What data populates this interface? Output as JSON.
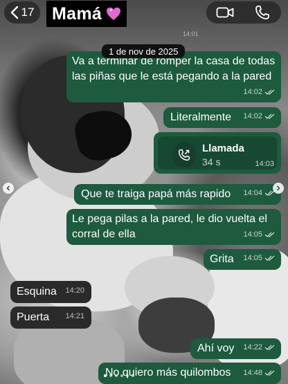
{
  "header": {
    "back_count": "17",
    "contact_name": "Mamá",
    "heart_icon": "purple-heart-icon",
    "video_icon": "video-camera-icon",
    "phone_icon": "phone-icon"
  },
  "date_chip": "1 de nov de 2025",
  "messages": [
    {
      "direction": "out",
      "text": "Va a terminar de romper la casa de todas las piñas que le está pegando a la pared",
      "time": "14:02",
      "status": "read"
    },
    {
      "direction": "out",
      "text": "Literalmente",
      "time": "14:02",
      "status": "read"
    },
    {
      "direction": "out",
      "type": "call",
      "call_label": "Llamada",
      "duration": "34 s",
      "time": "14:03"
    },
    {
      "direction": "out",
      "text": "Que te traiga papá más rapido",
      "time": "14:04",
      "status": "read"
    },
    {
      "direction": "out",
      "text": "Le pega pilas a la pared, le dio vuelta el corral de ella",
      "time": "14:05",
      "status": "read"
    },
    {
      "direction": "out",
      "text": "Grita",
      "time": "14:05",
      "status": "read"
    },
    {
      "direction": "in",
      "text": "Esquina",
      "time": "14:20"
    },
    {
      "direction": "in",
      "text": "Puerta",
      "time": "14:21"
    },
    {
      "direction": "out",
      "text": "Ahí voy",
      "time": "14:22",
      "status": "read"
    },
    {
      "direction": "out",
      "text": "No quiero más quilombos",
      "time": "14:48",
      "status": "read"
    }
  ],
  "colors": {
    "outgoing_bubble": "#1d5a3e",
    "incoming_bubble": "#2a2a2a",
    "read_ticks": "#8fb8a4"
  }
}
